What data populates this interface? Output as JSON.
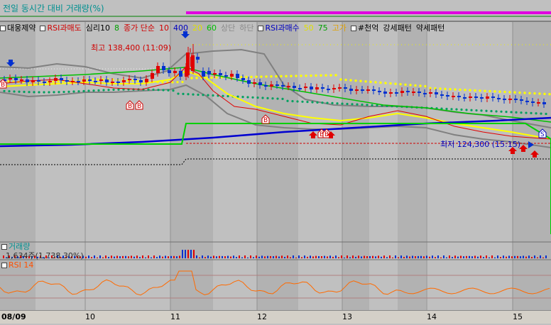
{
  "top_indicator": {
    "label": "전일 동시간 대비 거래량(%)"
  },
  "legend": [
    {
      "text": "대웅제약",
      "color": "#000000",
      "box": true
    },
    {
      "text": "RSI과매도",
      "color": "#d00000",
      "box": true
    },
    {
      "text": "심리10",
      "color": "#000000"
    },
    {
      "text": "8",
      "color": "#00a000"
    },
    {
      "text": "종가 단순",
      "color": "#d00000"
    },
    {
      "text": "10",
      "color": "#d00000"
    },
    {
      "text": "400",
      "color": "#0000c0"
    },
    {
      "text": "20",
      "color": "#e0e000"
    },
    {
      "text": "60",
      "color": "#00c000"
    },
    {
      "text": "상단",
      "color": "#8a8a8a"
    },
    {
      "text": "하단",
      "color": "#8a8a8a"
    },
    {
      "text": "RSI과매수",
      "color": "#0000c0",
      "box": true
    },
    {
      "text": "50",
      "color": "#e0e000"
    },
    {
      "text": "75",
      "color": "#00a000"
    },
    {
      "text": "고가",
      "color": "#e0a000"
    },
    {
      "text": "#천억",
      "color": "#000000",
      "box": true
    },
    {
      "text": "강세패턴",
      "color": "#000000"
    },
    {
      "text": "약세패턴",
      "color": "#000000"
    }
  ],
  "annotations": {
    "high_label": "최고 138,400 (11:09)",
    "low_label": "최저 124,300 (15:15)",
    "signal_b": "B",
    "signal_s": "S"
  },
  "volume_panel": {
    "title": "거래량",
    "value": "1,634주(1,738.30%)"
  },
  "rsi_panel": {
    "title": "RSI 14"
  },
  "x_axis": {
    "labels": [
      "08/09",
      "10",
      "11",
      "12",
      "13",
      "14",
      "15"
    ]
  },
  "colors": {
    "bg": "#c0c0c0",
    "shade": "#a8a8a8",
    "up": "#e00000",
    "down": "#0030d0",
    "ma10": "#e00000",
    "ma20": "#ffff00",
    "ma60": "#00c000",
    "ma400": "#0000d0",
    "band": "#808080",
    "rsi": "#ff6a00",
    "purple": "#e000e0",
    "highdots": "#ffff00",
    "psy": "#00a060",
    "step": "#00d000"
  }
}
